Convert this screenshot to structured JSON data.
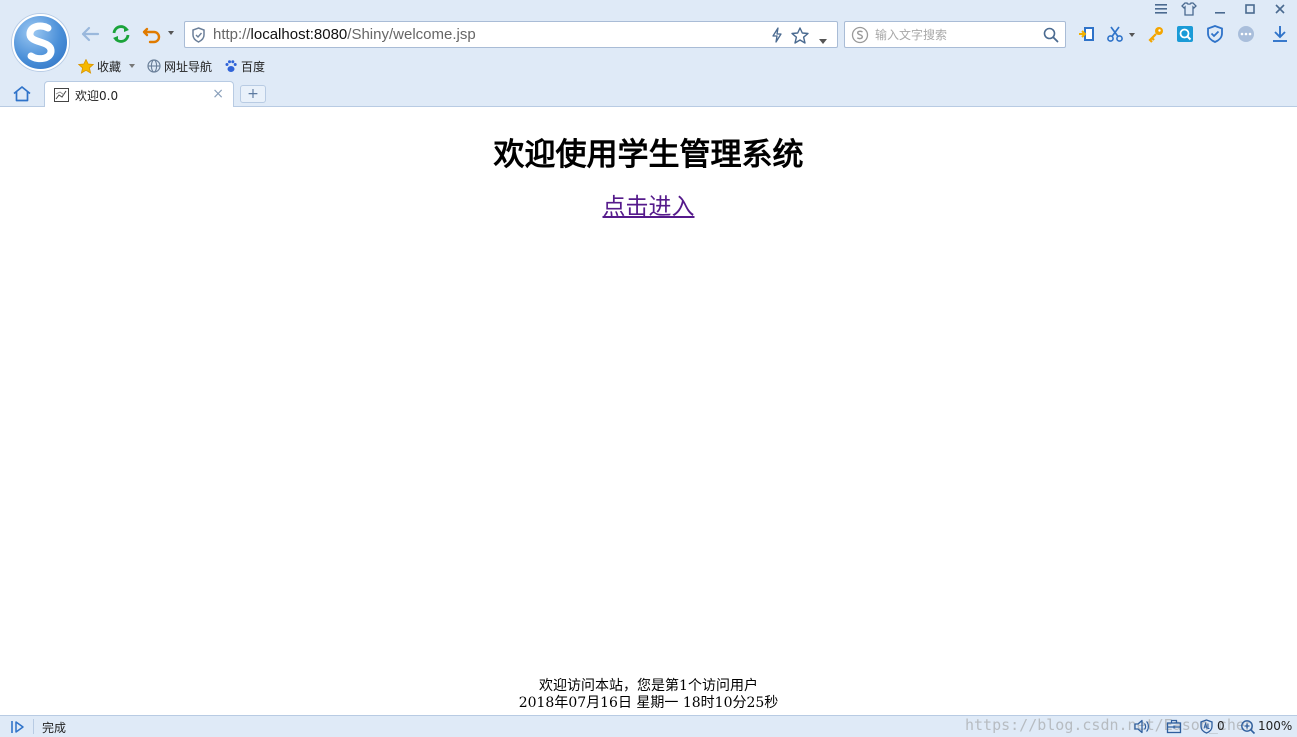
{
  "browser": {
    "address": {
      "scheme": "http://",
      "host": "localhost:8080",
      "path": "/Shiny/welcome.jsp"
    },
    "search": {
      "placeholder": "输入文字搜索"
    },
    "bookmarks": [
      {
        "label": "收藏",
        "icon": "star-icon"
      },
      {
        "label": "网址导航",
        "icon": "globe-icon"
      },
      {
        "label": "百度",
        "icon": "paw-icon"
      }
    ],
    "tabs": [
      {
        "title": "欢迎0.0",
        "close": "×"
      }
    ],
    "new_tab_label": "+"
  },
  "page": {
    "title": "欢迎使用学生管理系统",
    "enter_link": "点击进入",
    "footer": {
      "visit_line": "欢迎访问本站，您是第1个访问用户",
      "time_line": "2018年07月16日 星期一 18时10分25秒"
    }
  },
  "statusbar": {
    "status": "完成",
    "watermark": "https://blog.csdn.net/Eason_chen",
    "blocked_count": "0",
    "zoom": "100%"
  },
  "colors": {
    "chrome_bg": "#dfeaf7",
    "visited_link": "#551a8b",
    "refresh_green": "#1aa33a",
    "undo_orange": "#e07b00",
    "toolbar_blue": "#2f73c9"
  }
}
